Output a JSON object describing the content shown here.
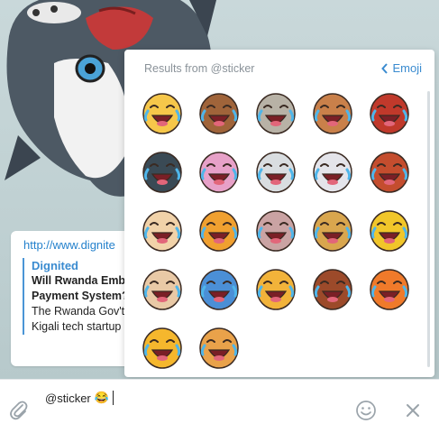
{
  "panel": {
    "header": "Results from @sticker",
    "emoji_link": "Emoji"
  },
  "message": {
    "link": "http://www.dignite",
    "site_name": "Dignited",
    "title_line1": "Will Rwanda Emb",
    "title_line2": "Payment System?",
    "desc_line1": "The Rwanda Gov't",
    "desc_line2": "Kigali tech startup"
  },
  "input": {
    "text": "@sticker",
    "emoji": "😂"
  },
  "stickers": [
    {
      "name": "sticker-blonde-girl-crying",
      "color": "#f6c74a"
    },
    {
      "name": "sticker-bearded-man-laughing",
      "color": "#a0643a"
    },
    {
      "name": "sticker-grey-cat-laughing",
      "color": "#b8b2a6"
    },
    {
      "name": "sticker-monkey-laughing",
      "color": "#c9804a"
    },
    {
      "name": "sticker-boy-crying",
      "color": "#c0392b"
    },
    {
      "name": "sticker-man-suit-crying",
      "color": "#3a4a55"
    },
    {
      "name": "sticker-pink-elephant",
      "color": "#e7a1c8"
    },
    {
      "name": "sticker-white-seal",
      "color": "#d9dde0"
    },
    {
      "name": "sticker-white-rabbit",
      "color": "#e4e4ea"
    },
    {
      "name": "sticker-red-panda",
      "color": "#c44d2e"
    },
    {
      "name": "sticker-dog-laughing",
      "color": "#f1d2a9"
    },
    {
      "name": "sticker-orange-cat-rolling",
      "color": "#f0a030"
    },
    {
      "name": "sticker-cow-laughing",
      "color": "#caa3a3"
    },
    {
      "name": "sticker-mouse-laughing",
      "color": "#d9a64e"
    },
    {
      "name": "sticker-duck-laughing",
      "color": "#f1c62a"
    },
    {
      "name": "sticker-old-man-laughing",
      "color": "#e9c9a6"
    },
    {
      "name": "sticker-robot-crying",
      "color": "#4b8fd6"
    },
    {
      "name": "sticker-chicken-laughing",
      "color": "#f2b33a"
    },
    {
      "name": "sticker-bull-laughing",
      "color": "#9c4a2a"
    },
    {
      "name": "sticker-fox-laughing",
      "color": "#f07a2a"
    },
    {
      "name": "sticker-emoji-face-laughing",
      "color": "#f5b72d"
    },
    {
      "name": "sticker-kangaroo-laughing",
      "color": "#e9a24a"
    }
  ]
}
